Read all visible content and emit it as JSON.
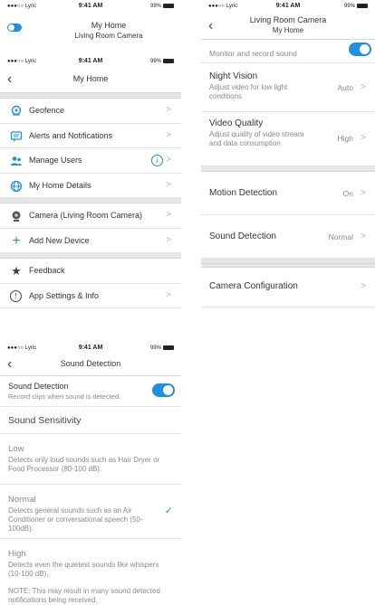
{
  "status": {
    "carrier": "●●●○○ Lyric",
    "time": "9:41 AM",
    "battery": "99%"
  },
  "top_header": {
    "title": "My Home",
    "subtitle": "Living Room Camera"
  },
  "menu": {
    "title": "My Home",
    "items": [
      {
        "label": "Geofence"
      },
      {
        "label": "Alerts and Notifications"
      },
      {
        "label": "Manage Users"
      },
      {
        "label": "My Home Details"
      },
      {
        "label": "Camera (Living Room Camera)"
      },
      {
        "label": "Add New Device"
      },
      {
        "label": "Feedback"
      },
      {
        "label": "App Settings & Info"
      }
    ]
  },
  "camera_settings": {
    "title": "Living Room Camera",
    "subtitle": "My Home",
    "monitor_desc": "Monitor and record sound",
    "night_vision": {
      "title": "Night Vision",
      "desc": "Adjust video for low light conditions",
      "value": "Auto"
    },
    "video_quality": {
      "title": "Video Quality",
      "desc": "Adjust quality of video stream and data consumption",
      "value": "High"
    },
    "motion": {
      "title": "Motion Detection",
      "value": "On"
    },
    "sound": {
      "title": "Sound Detection",
      "value": "Normal"
    },
    "config": {
      "title": "Camera Configuration"
    }
  },
  "sound_screen": {
    "title": "Sound Detection",
    "toggle_title": "Sound Detection",
    "toggle_desc": "Record clips when sound is detected.",
    "sensitivity_header": "Sound Sensitivity",
    "low": {
      "title": "Low",
      "desc": "Detects only loud sounds such as Hair Dryer or Food Processor (80-100 dB)."
    },
    "normal": {
      "title": "Normal",
      "desc": "Detects general sounds such as an Air Conditioner or conversational speech (50-100dB)."
    },
    "high": {
      "title": "High",
      "desc": "Detects even the quietest sounds like whispers (10-100 dB)."
    },
    "note": "NOTE: This may result in many sound detected notifications being received."
  }
}
